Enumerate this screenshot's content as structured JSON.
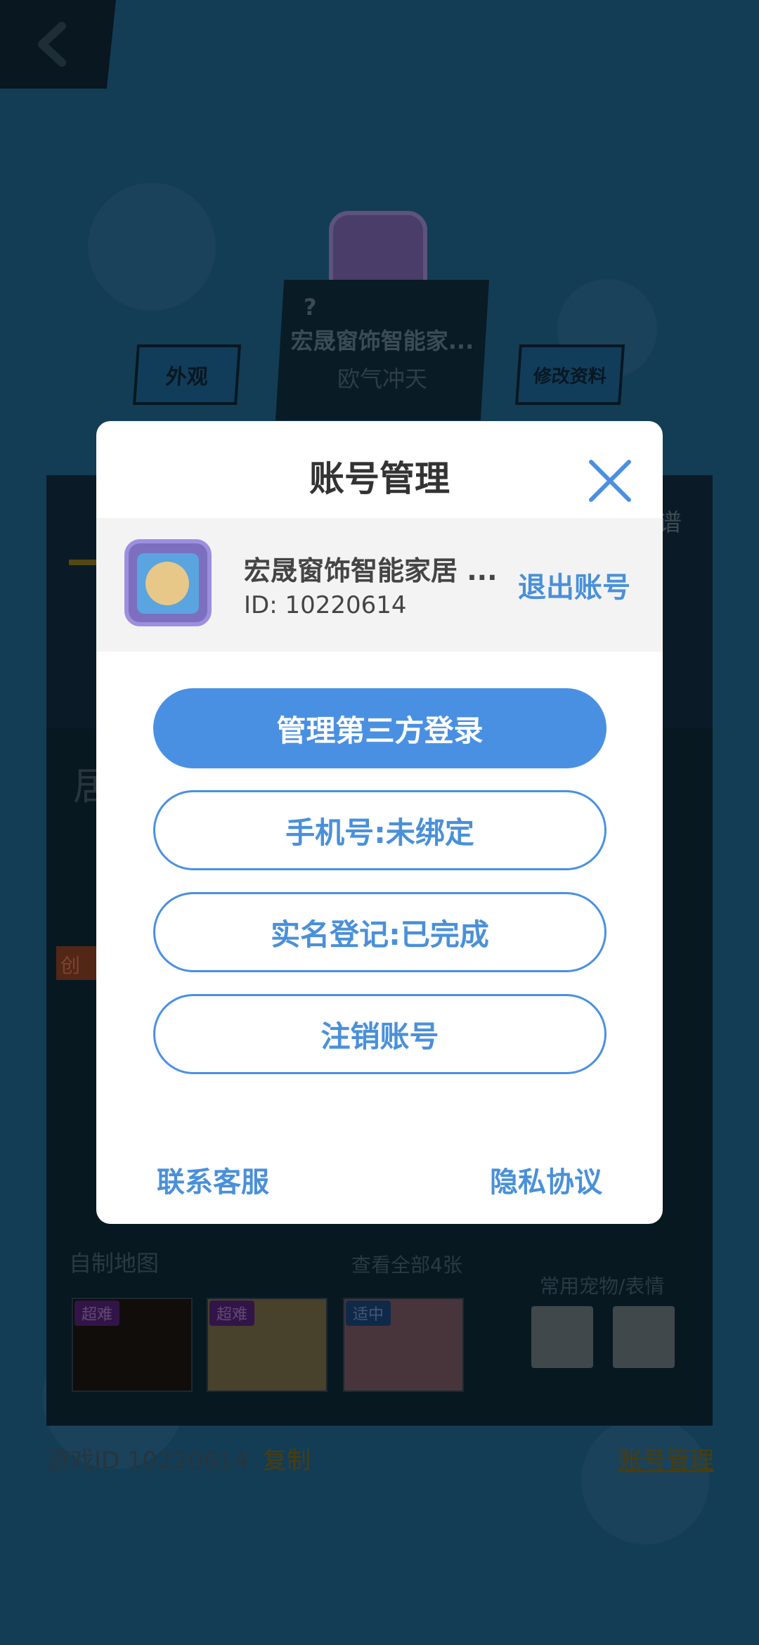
{
  "background": {
    "player_name": "宏晟窗饰智能家...",
    "player_title": "欧气冲天",
    "question_mark": "?",
    "appearance_button": "外观",
    "edit_profile_button": "修改资料",
    "tab_right_partial": "谱",
    "partial_text": "居",
    "tag_partial": "创",
    "custom_maps_label": "自制地图",
    "view_all_maps": "查看全部4张",
    "map_difficulties": [
      "超难",
      "超难",
      "适中"
    ],
    "common_pets_label": "常用宠物/表情",
    "game_id_label": "游戏ID 10220614",
    "copy_label": "复制",
    "account_management_link": "账号管理"
  },
  "modal": {
    "title": "账号管理",
    "account": {
      "name": "宏晟窗饰智能家居 ...",
      "id": "ID: 10220614",
      "logout_label": "退出账号"
    },
    "buttons": {
      "third_party_login": "管理第三方登录",
      "phone": "手机号:未绑定",
      "real_name": "实名登记:已完成",
      "delete_account": "注销账号"
    },
    "footer": {
      "contact_support": "联系客服",
      "privacy_policy": "隐私协议"
    }
  },
  "colors": {
    "accent": "#4a90e2",
    "background": "#1c5a7e",
    "modal_bg": "#ffffff",
    "account_row_bg": "#f3f3f3"
  }
}
